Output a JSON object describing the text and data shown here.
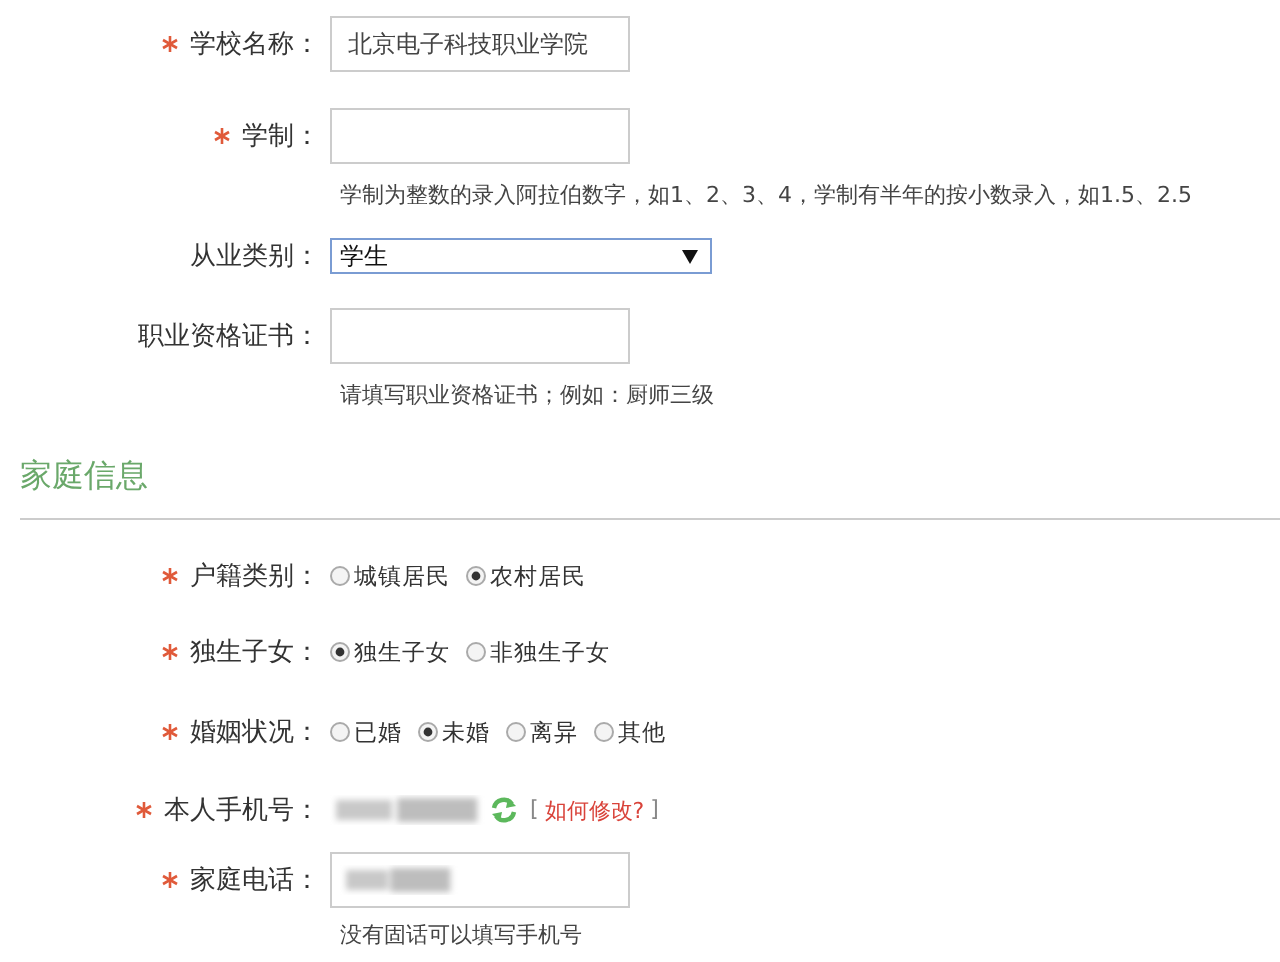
{
  "fields": [
    {
      "kind": "text",
      "required": true,
      "label": "学校名称：",
      "value": "北京电子科技职业学院"
    },
    {
      "kind": "text",
      "required": true,
      "label": "学制：",
      "hint": "学制为整数的录入阿拉伯数字，如1、2、3、4，学制有半年的按小数录入，如1.5、2.5"
    },
    {
      "kind": "select",
      "required": false,
      "label": "从业类别：",
      "value": "学生"
    },
    {
      "kind": "text",
      "required": false,
      "label": "职业资格证书：",
      "hint": "请填写职业资格证书；例如：厨师三级"
    }
  ],
  "section": {
    "title": "家庭信息"
  },
  "family_fields": [
    {
      "kind": "radio",
      "required": true,
      "label": "户籍类别：",
      "options": [
        {
          "label": "城镇居民",
          "selected": false
        },
        {
          "label": "农村居民",
          "selected": true
        }
      ]
    },
    {
      "kind": "radio",
      "required": true,
      "label": "独生子女：",
      "options": [
        {
          "label": "独生子女",
          "selected": true
        },
        {
          "label": "非独生子女",
          "selected": false
        }
      ]
    },
    {
      "kind": "radio",
      "required": true,
      "label": "婚姻状况：",
      "options": [
        {
          "label": "已婚",
          "selected": false
        },
        {
          "label": "未婚",
          "selected": true
        },
        {
          "label": "离异",
          "selected": false
        },
        {
          "label": "其他",
          "selected": false
        }
      ]
    },
    {
      "kind": "phone",
      "required": true,
      "label": "本人手机号：",
      "link": {
        "open": "[",
        "label": "如何修改?",
        "close": "]"
      }
    },
    {
      "kind": "redacted_input",
      "required": true,
      "label": "家庭电话：",
      "hint": "没有固话可以填写手机号"
    }
  ]
}
